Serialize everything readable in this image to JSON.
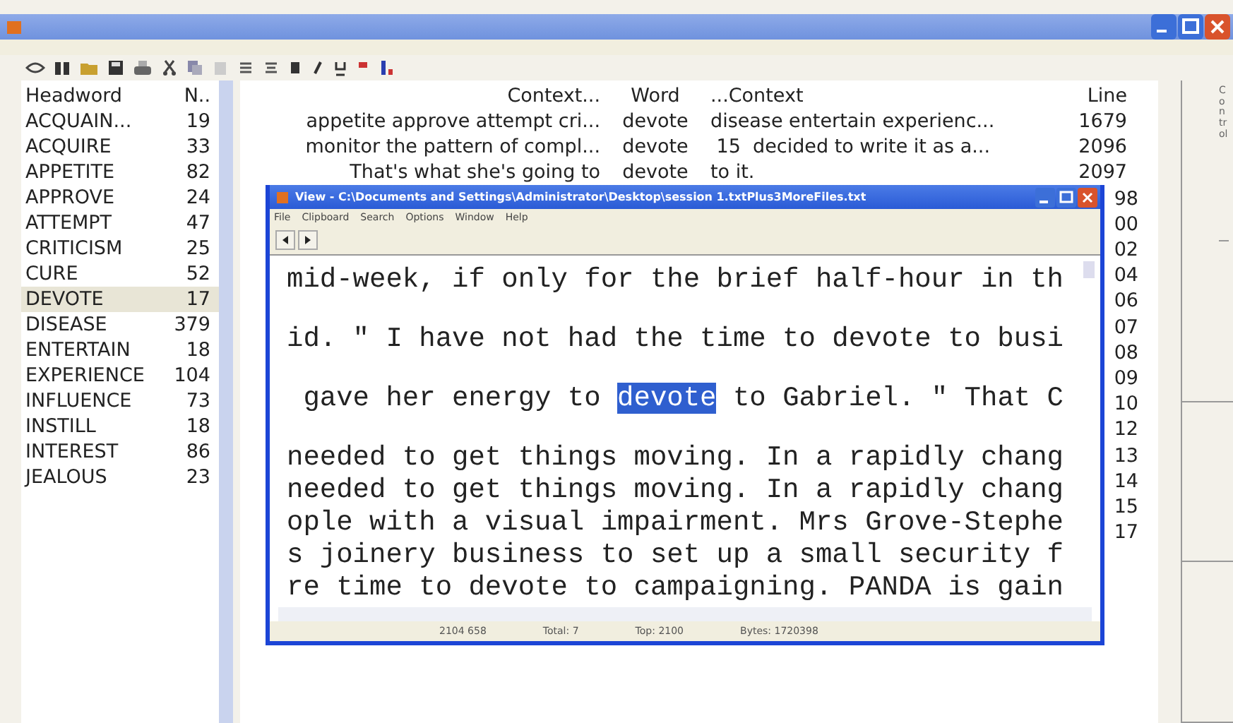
{
  "headwords": {
    "columns": [
      "Headword",
      "N.."
    ],
    "items": [
      {
        "word": "ACQUAIN...",
        "count": "19",
        "selected": false
      },
      {
        "word": "ACQUIRE",
        "count": "33",
        "selected": false
      },
      {
        "word": "APPETITE",
        "count": "82",
        "selected": false
      },
      {
        "word": "APPROVE",
        "count": "24",
        "selected": false
      },
      {
        "word": "ATTEMPT",
        "count": "47",
        "selected": false
      },
      {
        "word": "CRITICISM",
        "count": "25",
        "selected": false
      },
      {
        "word": "CURE",
        "count": "52",
        "selected": false
      },
      {
        "word": "DEVOTE",
        "count": "17",
        "selected": true
      },
      {
        "word": "DISEASE",
        "count": "379",
        "selected": false
      },
      {
        "word": "ENTERTAIN",
        "count": "18",
        "selected": false
      },
      {
        "word": "EXPERIENCE",
        "count": "104",
        "selected": false
      },
      {
        "word": "INFLUENCE",
        "count": "73",
        "selected": false
      },
      {
        "word": "INSTILL",
        "count": "18",
        "selected": false
      },
      {
        "word": "INTEREST",
        "count": "86",
        "selected": false
      },
      {
        "word": "JEALOUS",
        "count": "23",
        "selected": false
      }
    ]
  },
  "concordance": {
    "columns": [
      "Context...",
      "Word",
      "...Context",
      "Line"
    ],
    "rows": [
      {
        "left": "appetite approve attempt cri...",
        "word": "devote",
        "right": "disease entertain experienc...",
        "line": "1679"
      },
      {
        "left": "monitor the pattern of compl...",
        "word": "devote",
        "right": " 15  decided to write it as a...",
        "line": "2096"
      },
      {
        "left": "That's what she's going to",
        "word": "devote",
        "right": "to it.",
        "line": "2097"
      }
    ],
    "covered_lines": [
      "98",
      "00",
      "02",
      "04",
      "06",
      "07",
      "08",
      "09",
      "10",
      "12",
      "13",
      "14",
      "15",
      "17"
    ]
  },
  "side_tabs": [
    "Control"
  ],
  "viewer": {
    "title": "View - C:\\Documents and Settings\\Administrator\\Desktop\\session 1.txtPlus3MoreFiles.txt",
    "menu": [
      "File",
      "Clipboard",
      "Search",
      "Options",
      "Window",
      "Help"
    ],
    "lines": [
      {
        "kind": "spaced",
        "text": "mid-week, if only for the brief half-hour in th"
      },
      {
        "kind": "spaced",
        "text": "id. \" I have not had the time to devote to busi"
      },
      {
        "kind": "spaced",
        "text": " gave her energy to ",
        "match": "devote",
        "after": " to Gabriel. \" That C"
      },
      {
        "kind": "dense",
        "text": "needed to get things moving. In a rapidly chang"
      },
      {
        "kind": "dense",
        "text": "needed to get things moving. In a rapidly chang"
      },
      {
        "kind": "dense",
        "text": "ople with a visual impairment. Mrs Grove-Stephe"
      },
      {
        "kind": "dense",
        "text": "s joinery business to set up a small security f"
      },
      {
        "kind": "dense",
        "text": "re time to devote to campaigning. PANDA is gain"
      }
    ],
    "status": [
      "2104 658",
      "Total: 7",
      "Top: 2100",
      "Bytes: 1720398"
    ]
  }
}
